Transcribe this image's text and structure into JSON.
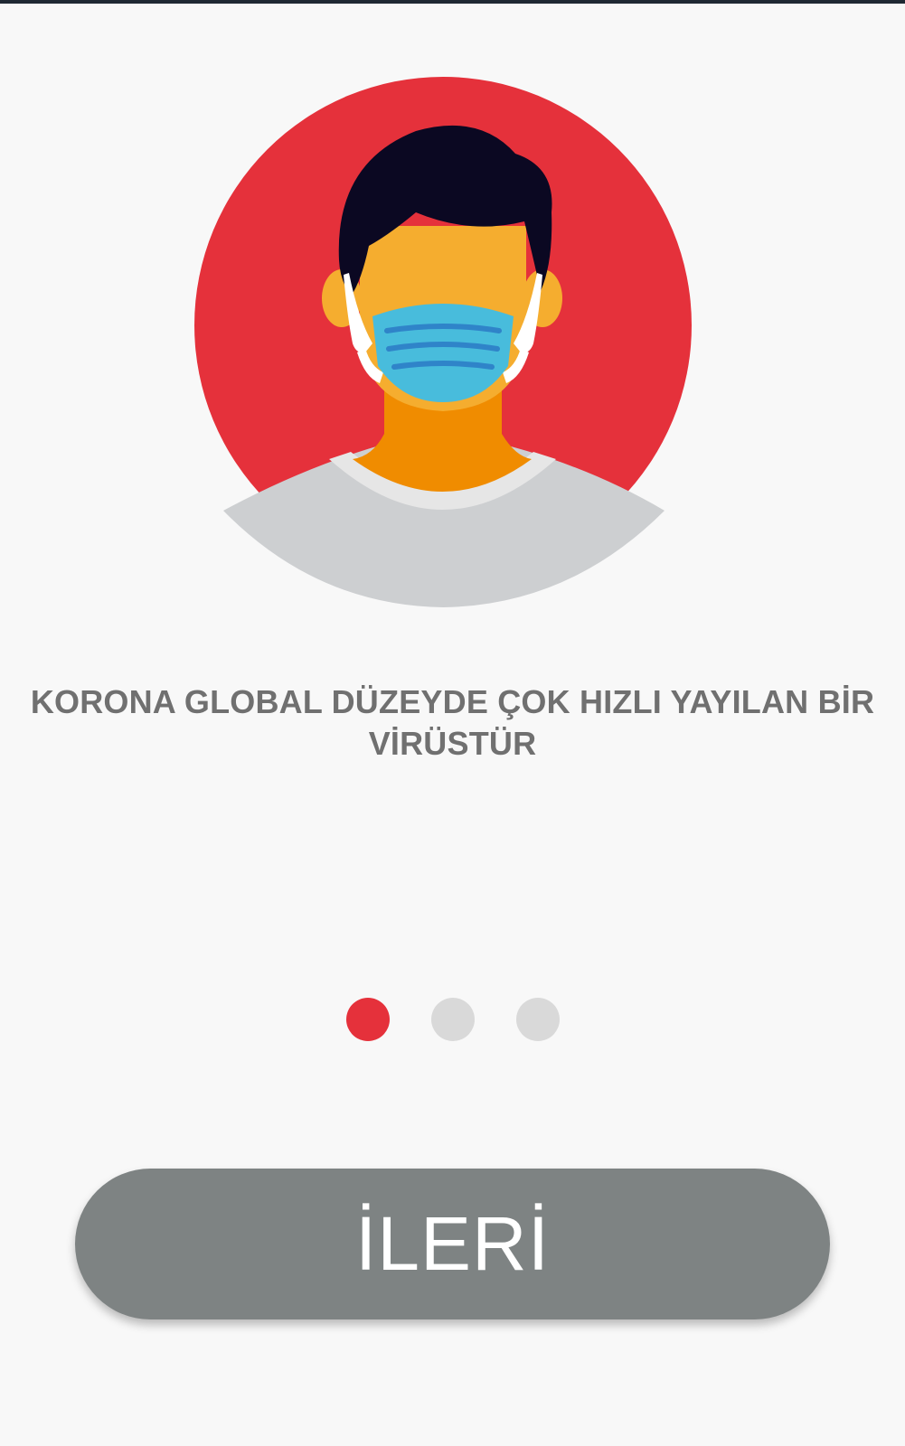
{
  "onboarding": {
    "message": "KORONA GLOBAL DÜZEYDE ÇOK HIZLI YAYILAN BİR VİRÜSTÜR",
    "illustration_icon": "masked-person-illustration",
    "page_indicator": {
      "total": 3,
      "current": 1
    },
    "next_button_label": "İLERİ"
  },
  "colors": {
    "accent": "#e5313b",
    "inactive_dot": "#d9d9d9",
    "button": "#7e8383",
    "text": "#707070",
    "background": "#f8f8f8"
  }
}
